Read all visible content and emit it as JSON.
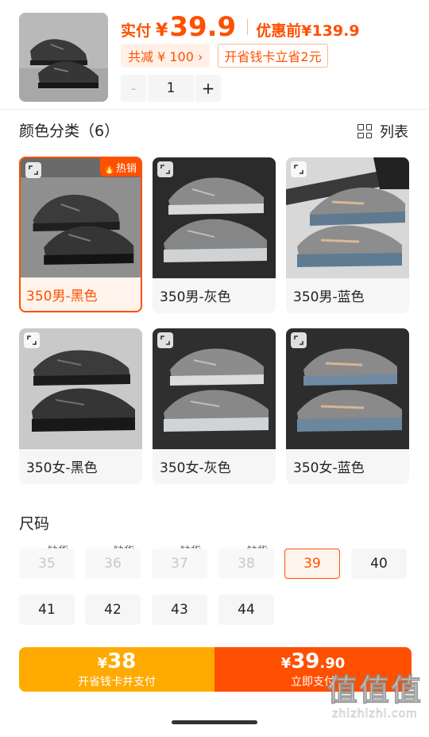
{
  "header": {
    "pay_label": "实付",
    "currency": "¥",
    "pay_amount": "39.9",
    "original_price": "优惠前¥139.9",
    "discount_chip": "共减 ¥ 100 ›",
    "card_chip": "开省钱卡立省2元",
    "quantity": "1",
    "minus": "-",
    "plus": "+"
  },
  "colors": {
    "title": "颜色分类（6）",
    "list_label": "列表",
    "hot_badge": "热销",
    "items": [
      {
        "label": "350男-黑色",
        "tone": "black",
        "selected": true
      },
      {
        "label": "350男-灰色",
        "tone": "grey",
        "selected": false
      },
      {
        "label": "350男-蓝色",
        "tone": "blue",
        "selected": false
      },
      {
        "label": "350女-黑色",
        "tone": "black",
        "selected": false
      },
      {
        "label": "350女-灰色",
        "tone": "grey",
        "selected": false
      },
      {
        "label": "350女-蓝色",
        "tone": "blue",
        "selected": false
      }
    ]
  },
  "sizes": {
    "title": "尺码",
    "out_of_stock_label": "缺货",
    "items": [
      {
        "label": "35",
        "state": "disabled"
      },
      {
        "label": "36",
        "state": "disabled"
      },
      {
        "label": "37",
        "state": "disabled"
      },
      {
        "label": "38",
        "state": "disabled"
      },
      {
        "label": "39",
        "state": "selected"
      },
      {
        "label": "40",
        "state": "available"
      },
      {
        "label": "41",
        "state": "available"
      },
      {
        "label": "42",
        "state": "available"
      },
      {
        "label": "43",
        "state": "available"
      },
      {
        "label": "44",
        "state": "available"
      }
    ]
  },
  "bottom_bar": {
    "left_currency": "¥",
    "left_price": "38",
    "left_label": "开省钱卡并支付",
    "right_currency": "¥",
    "right_price_int": "39",
    "right_price_dec": ".90",
    "right_label": "立即支付"
  },
  "watermark": {
    "big": "值值值",
    "small": "zhizhizhi.com"
  },
  "colors_palette": {
    "accent": "#ff5000",
    "gold": "#ffaa00"
  }
}
